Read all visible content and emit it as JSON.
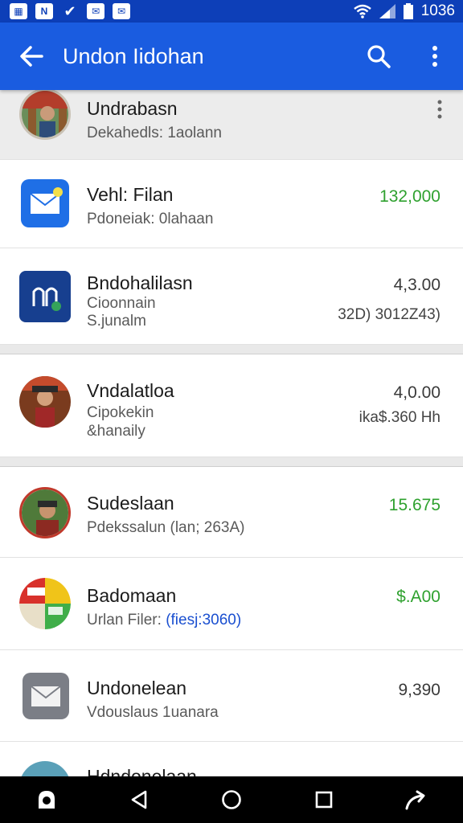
{
  "status_bar": {
    "time": "1036",
    "left_icons": [
      "qr-icon",
      "n-icon",
      "check-icon",
      "mail-icon",
      "mail-icon"
    ]
  },
  "app_bar": {
    "title": "Undon Iidohan"
  },
  "rows": [
    {
      "title": "Undrabasn",
      "subtitle": "Dekahedls: 1aolann"
    },
    {
      "title": "Vehl: Filan",
      "subtitle": "Pdoneiak: 0lahaan",
      "amount": "132,000"
    },
    {
      "title": "Bndohalilasn",
      "subtitle_line1": "Cioonnain",
      "subtitle_line2": "S.junalm",
      "amount": "4,3.00",
      "sub_amount": "32D) 3012Z43)"
    },
    {
      "title": "Vndalatloa",
      "subtitle_line1": "Cipokekin",
      "subtitle_line2": "&hanaily",
      "amount": "4,0.00",
      "sub_amount": "ika$.360  Hh"
    },
    {
      "title": "Sudeslaan",
      "subtitle": "Pdekssalun (lan; 263A)",
      "amount": "15.675"
    },
    {
      "title": "Badomaan",
      "subtitle_plain": "Urlan Filer: ",
      "subtitle_link": "(fiesj:3060)",
      "amount": "$.A00"
    },
    {
      "title": "Undonelean",
      "subtitle": "Vdouslaus 1uanara",
      "amount": "9,390"
    },
    {
      "title": "Hdndonelaan"
    }
  ],
  "colors": {
    "status_bar": "#0d3fb8",
    "app_bar": "#1a5ce0",
    "positive_amount": "#2fa12f",
    "link": "#1a4fd0"
  }
}
